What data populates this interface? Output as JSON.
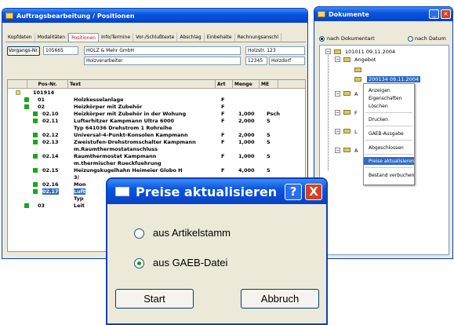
{
  "main_window": {
    "title": "Auftragsbearbeitung / Positionen",
    "tabs": [
      "Kopfdaten",
      "Modalitäten",
      "Positionen",
      "Info/Termine",
      "Vor-/Schlußtexte",
      "Abschlag",
      "Einbehalte",
      "Rechnungsanschl"
    ],
    "active_tab": "Positionen",
    "vorgang_button": "Vorgangs-Nr.",
    "vorgang_nr": "105665",
    "customer_name": "HOLZ & Mehr GmbH",
    "customer_sub": "Holzverarbeiter",
    "street": "Holzstr. 123",
    "zip": "12345",
    "city": "Holzdorf"
  },
  "grid": {
    "columns": [
      "Pos-Nr.",
      "Text",
      "Art",
      "Menge",
      "ME"
    ],
    "rows": [
      {
        "pos": "101914",
        "text": "",
        "art": "",
        "menge": "",
        "me": ""
      },
      {
        "pos": "01",
        "text": "Holzkesselanlage",
        "art": "F",
        "menge": "",
        "me": ""
      },
      {
        "pos": "02",
        "text": "Heizkörper mit Zubehör",
        "art": "F",
        "menge": "",
        "me": ""
      },
      {
        "pos": "02.10",
        "text": "Heizkörper mit Zubehör in der Wohung",
        "art": "F",
        "menge": "1,000",
        "me": "Psch"
      },
      {
        "pos": "02.11",
        "text": "Lufterhitzer Kampmann Ultra 6000",
        "art": "F",
        "menge": "2,000",
        "me": "S"
      },
      {
        "pos": "",
        "text": "Typ 641036 Drehstrom 1 Rohreihe",
        "art": "",
        "menge": "",
        "me": ""
      },
      {
        "pos": "02.12",
        "text": "Universal-4-Punkt-Konsolen Kampmann",
        "art": "F",
        "menge": "2,000",
        "me": "S"
      },
      {
        "pos": "02.13",
        "text": "Zweistufen-Drehstromschalter Kampmann",
        "art": "F",
        "menge": "1,000",
        "me": "S"
      },
      {
        "pos": "",
        "text": "m.Raumthermostatanschluss",
        "art": "",
        "menge": "",
        "me": ""
      },
      {
        "pos": "02.14",
        "text": "Raumthermostat Kampmann",
        "art": "F",
        "menge": "1,000",
        "me": "S"
      },
      {
        "pos": "",
        "text": "m.thermischer Rueckfuehrung",
        "art": "",
        "menge": "",
        "me": ""
      },
      {
        "pos": "02.15",
        "text": "Heizungskugelhahn Heimeier Globo H",
        "art": "F",
        "menge": "4,000",
        "me": "S"
      },
      {
        "pos": "",
        "text": "3/",
        "art": "",
        "menge": "",
        "me": ""
      },
      {
        "pos": "02.16",
        "text": "Mon",
        "art": "",
        "menge": "",
        "me": ""
      },
      {
        "pos": "02.17",
        "text": "Luft",
        "art": "",
        "menge": "",
        "me": ""
      },
      {
        "pos": "",
        "text": "Typ",
        "art": "",
        "menge": "",
        "me": ""
      },
      {
        "pos": "03",
        "text": "Leit",
        "art": "",
        "menge": "",
        "me": ""
      }
    ]
  },
  "documents_window": {
    "title": "Dokumente",
    "radio_by_type": "nach Dokumentart",
    "radio_by_date": "nach Datum",
    "tree": {
      "root": "101011 09.11.2004",
      "child": "Angebot",
      "selected": "200134 09.11.2004",
      "letters": [
        "A",
        "F",
        "L",
        "A"
      ]
    },
    "context_menu": [
      "Anzeigen",
      "Eigenschaften",
      "Löschen",
      "Drucken",
      "GAEB-Ausgabe",
      "Abgeschlossen",
      "Preise aktualisieren",
      "Bestand verbuchen"
    ],
    "highlighted_menu_item": "Preise aktualisieren"
  },
  "dialog": {
    "title": "Preise aktualisieren",
    "help_glyph": "?",
    "close_glyph": "X",
    "option1": "aus Artikelstamm",
    "option2": "aus GAEB-Datei",
    "selected_option": "aus GAEB-Datei",
    "start": "Start",
    "cancel": "Abbruch"
  }
}
